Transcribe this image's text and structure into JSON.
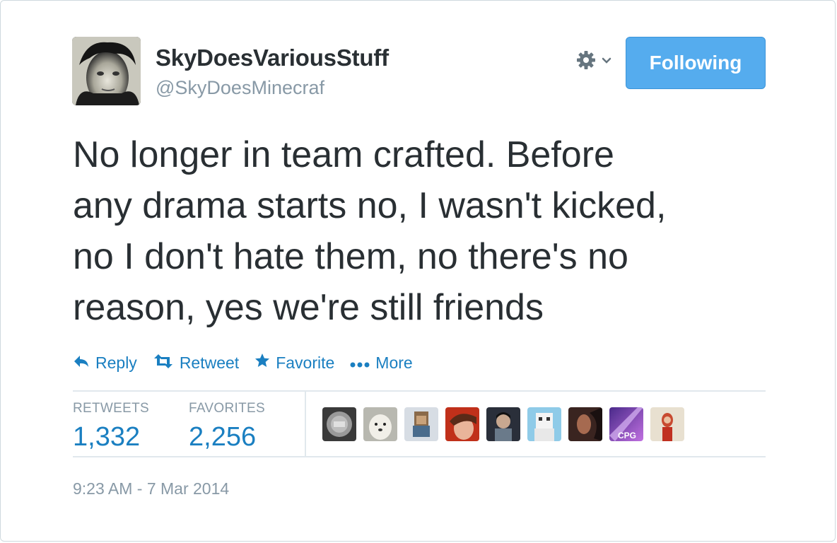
{
  "user": {
    "display_name": "SkyDoesVariousStuff",
    "handle": "@SkyDoesMinecraf"
  },
  "header": {
    "follow_label": "Following",
    "menu_icon": "gear-icon"
  },
  "tweet": {
    "text": "No longer in team crafted. Before\nany drama starts no, I wasn't kicked,\nno I don't hate them, no there's no\nreason, yes we're still friends",
    "timestamp": "9:23 AM - 7 Mar 2014"
  },
  "actions": {
    "reply": "Reply",
    "retweet": "Retweet",
    "favorite": "Favorite",
    "more": "More"
  },
  "stats": {
    "retweets_label": "RETWEETS",
    "retweets_value": "1,332",
    "favorites_label": "FAVORITES",
    "favorites_value": "2,256"
  },
  "favoriters": [
    {
      "name": "favoriter-avatar-1"
    },
    {
      "name": "favoriter-avatar-2"
    },
    {
      "name": "favoriter-avatar-3"
    },
    {
      "name": "favoriter-avatar-4"
    },
    {
      "name": "favoriter-avatar-5"
    },
    {
      "name": "favoriter-avatar-6"
    },
    {
      "name": "favoriter-avatar-7"
    },
    {
      "name": "favoriter-avatar-8",
      "label": "CPG"
    },
    {
      "name": "favoriter-avatar-9"
    }
  ],
  "colors": {
    "accent": "#55acee",
    "link": "#1a7fc1",
    "muted": "#8899a6",
    "text": "#292f33"
  }
}
